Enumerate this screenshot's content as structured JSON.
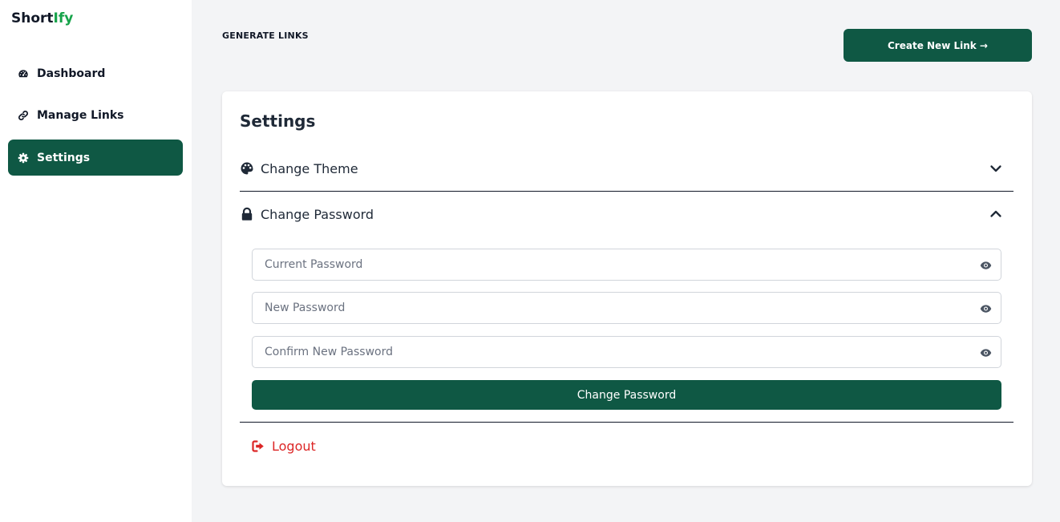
{
  "app": {
    "name_main": "Short",
    "name_accent": "Ify"
  },
  "colors": {
    "primary": "#0f5844",
    "accent": "#16a34a",
    "danger": "#dc2626",
    "background": "#f3f4f6"
  },
  "sidebar": {
    "items": [
      {
        "label": "Dashboard",
        "icon": "gauge-icon",
        "active": false
      },
      {
        "label": "Manage Links",
        "icon": "link-icon",
        "active": false
      },
      {
        "label": "Settings",
        "icon": "gear-icon",
        "active": true
      }
    ]
  },
  "header": {
    "title": "GENERATE LINKS",
    "create_label": "Create New Link →"
  },
  "settings": {
    "title": "Settings",
    "theme": {
      "label": "Change Theme",
      "icon": "palette-icon",
      "expanded": false
    },
    "password": {
      "label": "Change Password",
      "icon": "lock-icon",
      "expanded": true,
      "fields": {
        "current": {
          "placeholder": "Current Password",
          "value": ""
        },
        "new": {
          "placeholder": "New Password",
          "value": ""
        },
        "confirm": {
          "placeholder": "Confirm New Password",
          "value": ""
        }
      },
      "submit_label": "Change Password"
    },
    "logout_label": "Logout"
  }
}
